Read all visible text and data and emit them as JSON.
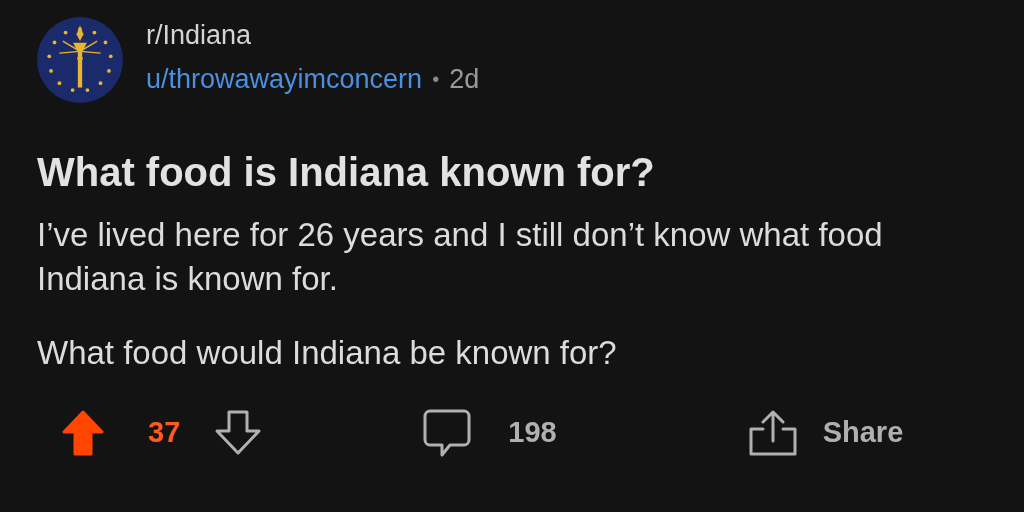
{
  "post": {
    "subreddit": "r/Indiana",
    "author": "u/throwawayimconcern",
    "separator": "•",
    "age": "2d",
    "title": "What food is Indiana known for?",
    "body": [
      "I’ve lived here for 26 years and I still don’t know what food Indiana is known for.",
      "What food would Indiana be known for?"
    ]
  },
  "actions": {
    "upvoted": true,
    "score": "37",
    "comments": "198",
    "share": "Share"
  }
}
